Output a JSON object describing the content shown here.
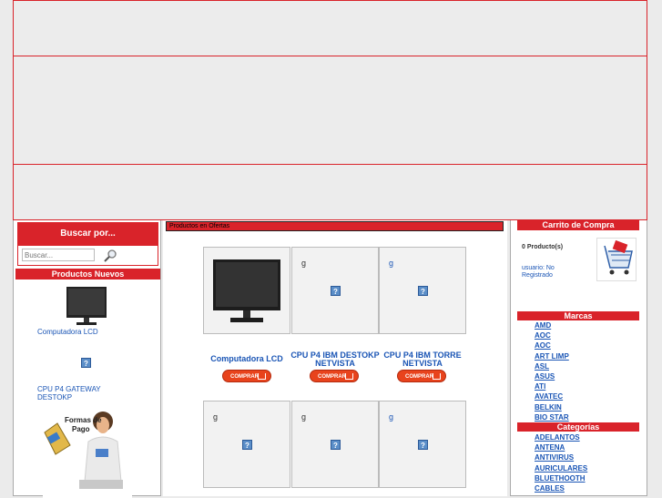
{
  "search": {
    "title": "Buscar por...",
    "placeholder": "Buscar..."
  },
  "new_products": {
    "title": "Productos Nuevos",
    "items": [
      {
        "name": "Computadora LCD"
      },
      {
        "name": "CPU P4 GATEWAY DESTOKP"
      }
    ]
  },
  "offers": {
    "title": "Productos en Ofertas",
    "row1": [
      {
        "image": "monitor",
        "name": "Computadora LCD",
        "buy": "COMPRAR"
      },
      {
        "image": "g",
        "name": "CPU P4 IBM DESTOKP NETVISTA",
        "buy": "COMPRAR"
      },
      {
        "image": "g",
        "name": "CPU P4 IBM TORRE NETVISTA",
        "buy": "COMPRAR"
      }
    ],
    "row2": [
      "g",
      "g",
      "g"
    ]
  },
  "cart": {
    "title": "Carrito de Compra",
    "count": "0 Producto(s)",
    "user": "usuario: No Registrado"
  },
  "brands": {
    "title": "Marcas",
    "items": [
      "AMD",
      "AOC",
      "AOC",
      "ART LIMP",
      "ASL",
      "ASUS",
      "ATI",
      "AVATEC",
      "BELKIN",
      "BIO STAR"
    ]
  },
  "categories": {
    "title": "Categorías",
    "items": [
      "ADELANTOS",
      "ANTENA",
      "ANTIVIRUS",
      "AURICULARES",
      "BLUETHOOTH",
      "CABLES"
    ]
  },
  "promo": {
    "text": "Formas de Pago"
  },
  "colors": {
    "accent": "#d9232a",
    "link": "#1a55b5"
  }
}
